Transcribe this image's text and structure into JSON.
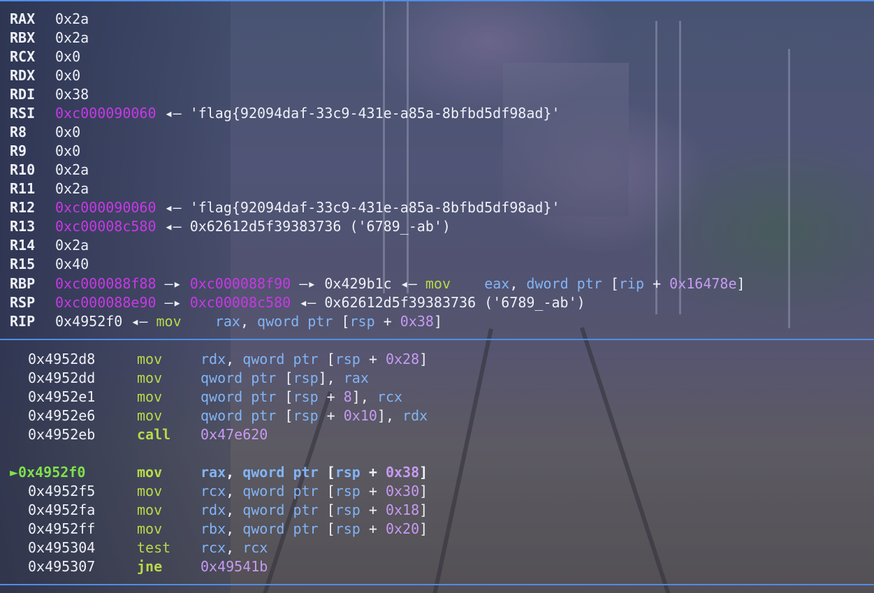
{
  "registers": [
    {
      "name": "RAX",
      "value": "0x2a"
    },
    {
      "name": "RBX",
      "value": "0x2a"
    },
    {
      "name": "RCX",
      "value": "0x0"
    },
    {
      "name": "RDX",
      "value": "0x0"
    },
    {
      "name": "RDI",
      "value": "0x38"
    },
    {
      "name": "RSI",
      "value": "0xc000090060",
      "arrow": "◂—",
      "deref": "'flag{92094daf-33c9-431e-a85a-8bfbd5df98ad}'"
    },
    {
      "name": "R8",
      "value": "0x0"
    },
    {
      "name": "R9",
      "value": "0x0"
    },
    {
      "name": "R10",
      "value": "0x2a"
    },
    {
      "name": "R11",
      "value": "0x2a"
    },
    {
      "name": "R12",
      "value": "0xc000090060",
      "arrow": "◂—",
      "deref": "'flag{92094daf-33c9-431e-a85a-8bfbd5df98ad}'"
    },
    {
      "name": "R13",
      "value": "0xc00008c580",
      "arrow": "◂—",
      "deref": "0x62612d5f39383736 ('6789_-ab')"
    },
    {
      "name": "R14",
      "value": "0x2a"
    },
    {
      "name": "R15",
      "value": "0x40"
    }
  ],
  "rbp": {
    "name": "RBP",
    "chain1": "0xc000088f88",
    "chain2": "0xc000088f90",
    "chain3": "0x429b1c",
    "arrow_fwd": "—▸",
    "arrow_back": "◂—",
    "mnemonic": "mov",
    "op_dst": "eax",
    "op_size": "dword",
    "op_ptr": "ptr",
    "op_base": "rip",
    "op_plus": "+",
    "op_disp": "0x16478e"
  },
  "rsp": {
    "name": "RSP",
    "chain1": "0xc000088e90",
    "chain2": "0xc00008c580",
    "arrow_fwd": "—▸",
    "arrow_back": "◂—",
    "deref": "0x62612d5f39383736 ('6789_-ab')"
  },
  "rip": {
    "name": "RIP",
    "value": "0x4952f0",
    "arrow": "◂—",
    "mnemonic": "mov",
    "op_dst": "rax",
    "op_size": "qword",
    "op_ptr": "ptr",
    "op_base": "rsp",
    "op_plus": "+",
    "op_disp": "0x38"
  },
  "disasm_before": [
    {
      "addr": "0x4952d8",
      "mn": "mov",
      "a1": "rdx",
      "size": "qword",
      "ptr": "ptr",
      "base": "rsp",
      "plus": "+",
      "disp": "0x28",
      "tail": ""
    },
    {
      "addr": "0x4952dd",
      "mn": "mov",
      "size": "qword",
      "ptr": "ptr",
      "base": "rsp",
      "tail_reg": "rax"
    },
    {
      "addr": "0x4952e1",
      "mn": "mov",
      "size": "qword",
      "ptr": "ptr",
      "base": "rsp",
      "plus": "+",
      "disp": "8",
      "tail_reg": "rcx"
    },
    {
      "addr": "0x4952e6",
      "mn": "mov",
      "size": "qword",
      "ptr": "ptr",
      "base": "rsp",
      "plus": "+",
      "disp": "0x10",
      "tail_reg": "rdx"
    },
    {
      "addr": "0x4952eb",
      "mn": "call",
      "target": "0x47e620"
    }
  ],
  "current": {
    "marker": "►",
    "addr": "0x4952f0",
    "mn": "mov",
    "a1": "rax",
    "size": "qword",
    "ptr": "ptr",
    "base": "rsp",
    "plus": "+",
    "disp": "0x38"
  },
  "disasm_after": [
    {
      "addr": "0x4952f5",
      "mn": "mov",
      "a1": "rcx",
      "size": "qword",
      "ptr": "ptr",
      "base": "rsp",
      "plus": "+",
      "disp": "0x30"
    },
    {
      "addr": "0x4952fa",
      "mn": "mov",
      "a1": "rdx",
      "size": "qword",
      "ptr": "ptr",
      "base": "rsp",
      "plus": "+",
      "disp": "0x18"
    },
    {
      "addr": "0x4952ff",
      "mn": "mov",
      "a1": "rbx",
      "size": "qword",
      "ptr": "ptr",
      "base": "rsp",
      "plus": "+",
      "disp": "0x20"
    },
    {
      "addr": "0x495304",
      "mn": "test",
      "a1": "rcx",
      "a2": "rcx"
    },
    {
      "addr": "0x495307",
      "mn": "jne",
      "target": "0x49541b"
    }
  ],
  "colors": {
    "accent_divider": "#4f8de8",
    "pointer": "#c838e6",
    "mnemonic": "#b8d94a",
    "operand": "#82b4f5",
    "number": "#c79af2",
    "current": "#7ee04c"
  }
}
